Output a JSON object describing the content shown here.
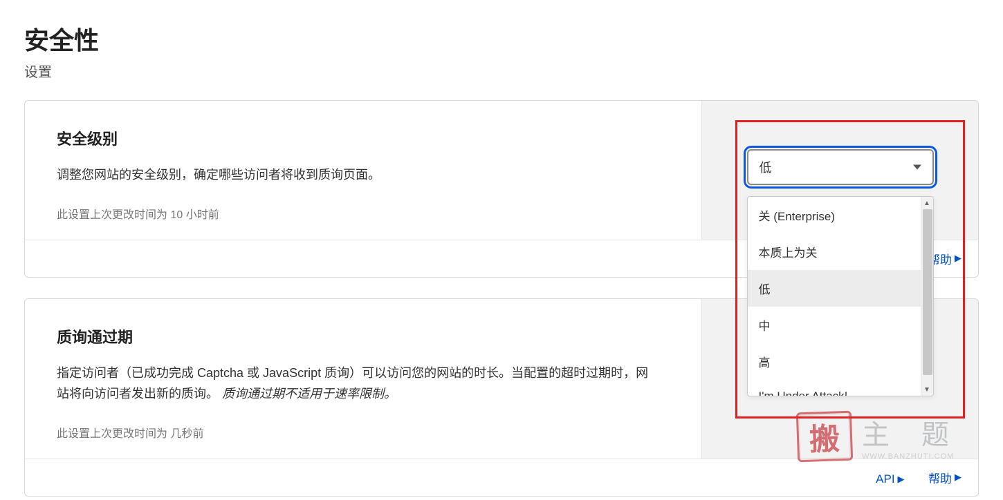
{
  "header": {
    "title": "安全性",
    "subtitle": "设置"
  },
  "card1": {
    "title": "安全级别",
    "desc": "调整您网站的安全级别，确定哪些访问者将收到质询页面。",
    "meta": "此设置上次更改时间为 10 小时前",
    "help_label": "帮助",
    "select": {
      "value": "低",
      "options": [
        "关 (Enterprise)",
        "本质上为关",
        "低",
        "中",
        "高",
        "I'm Under Attack!"
      ],
      "selected_index": 2
    }
  },
  "card2": {
    "title": "质询通过期",
    "desc_pre": "指定访问者（已成功完成 Captcha 或 JavaScript 质询）可以访问您的网站的时长。当配置的超时过期时，网站将向访问者发出新的质询。",
    "desc_italic": "质询通过期不适用于速率限制。",
    "meta": "此设置上次更改时间为 几秒前",
    "api_label": "API",
    "help_label": "帮助"
  },
  "watermark": {
    "seal": "搬",
    "main": "主 题",
    "url": "WWW.BANZHUTI.COM"
  }
}
